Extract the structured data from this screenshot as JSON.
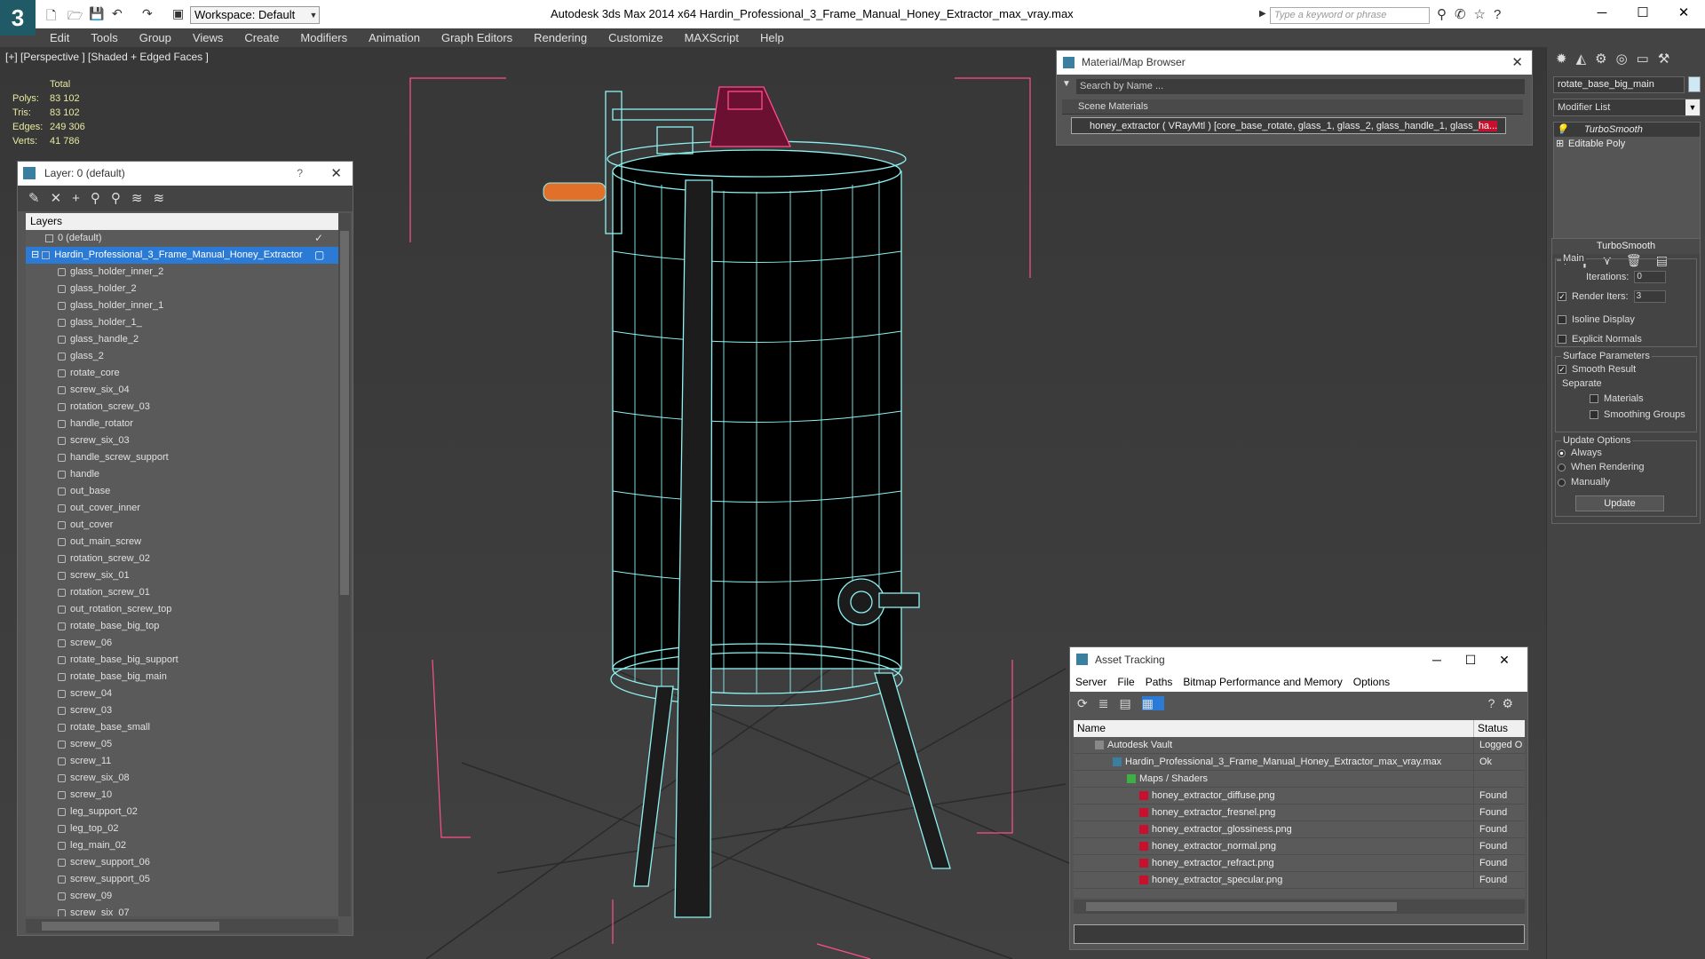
{
  "app": {
    "title": "Autodesk 3ds Max  2014 x64      Hardin_Professional_3_Frame_Manual_Honey_Extractor_max_vray.max",
    "logo": "3",
    "workspace": "Workspace: Default",
    "search_placeholder": "Type a keyword or phrase"
  },
  "menu": [
    "Edit",
    "Tools",
    "Group",
    "Views",
    "Create",
    "Modifiers",
    "Animation",
    "Graph Editors",
    "Rendering",
    "Customize",
    "MAXScript",
    "Help"
  ],
  "viewport": {
    "label": "[+] [Perspective ] [Shaded + Edged Faces ]",
    "stats": {
      "header": "Total",
      "polys_label": "Polys:",
      "polys": "83 102",
      "tris_label": "Tris:",
      "tris": "83 102",
      "edges_label": "Edges:",
      "edges": "249 306",
      "verts_label": "Verts:",
      "verts": "41 786"
    }
  },
  "layer_panel": {
    "title": "Layer: 0 (default)",
    "help": "?",
    "column_header": "Layers",
    "default_layer": "0 (default)",
    "selected_layer": "Hardin_Professional_3_Frame_Manual_Honey_Extractor",
    "items": [
      "glass_holder_inner_2",
      "glass_holder_2",
      "glass_holder_inner_1",
      "glass_holder_1_",
      "glass_handle_2",
      "glass_2",
      "rotate_core",
      "screw_six_04",
      "rotation_screw_03",
      "handle_rotator",
      "screw_six_03",
      "handle_screw_support",
      "handle",
      "out_base",
      "out_cover_inner",
      "out_cover",
      "out_main_screw",
      "rotation_screw_02",
      "screw_six_01",
      "rotation_screw_01",
      "out_rotation_screw_top",
      "rotate_base_big_top",
      "screw_06",
      "rotate_base_big_support",
      "rotate_base_big_main",
      "screw_04",
      "screw_03",
      "rotate_base_small",
      "screw_05",
      "screw_11",
      "screw_six_08",
      "screw_10",
      "leg_support_02",
      "leg_top_02",
      "leg_main_02",
      "screw_support_06",
      "screw_support_05",
      "screw_09",
      "screw_six_07"
    ]
  },
  "material_browser": {
    "title": "Material/Map Browser",
    "search_placeholder": "Search by Name ...",
    "section": "Scene Materials",
    "material_prefix": "honey_extractor  ( VRayMtl ) [core_base_rotate, glass_1, glass_2, glass_handle_1, glass_",
    "material_highlight": "ha..."
  },
  "command_panel": {
    "object_name": "rotate_base_big_main",
    "modifier_list": "Modifier List",
    "stack": [
      "TurboSmooth",
      "Editable Poly"
    ],
    "rollout_title": "TurboSmooth",
    "main_group": "Main",
    "iterations_label": "Iterations:",
    "iterations": "0",
    "render_iters_label": "Render Iters:",
    "render_iters": "3",
    "isoline": "Isoline Display",
    "explicit_normals": "Explicit Normals",
    "surface_group": "Surface Parameters",
    "smooth_result": "Smooth Result",
    "separate": "Separate",
    "materials": "Materials",
    "smoothing_groups": "Smoothing Groups",
    "update_group": "Update Options",
    "always": "Always",
    "when_rendering": "When Rendering",
    "manually": "Manually",
    "update_button": "Update"
  },
  "asset_tracking": {
    "title": "Asset Tracking",
    "menu": [
      "Server",
      "File",
      "Paths",
      "Bitmap Performance and Memory",
      "Options"
    ],
    "col_name": "Name",
    "col_status": "Status",
    "rows": [
      {
        "name": "Autodesk Vault",
        "status": "Logged O"
      },
      {
        "name": "Hardin_Professional_3_Frame_Manual_Honey_Extractor_max_vray.max",
        "status": "Ok"
      },
      {
        "name": "Maps / Shaders",
        "status": ""
      },
      {
        "name": "honey_extractor_diffuse.png",
        "status": "Found"
      },
      {
        "name": "honey_extractor_fresnel.png",
        "status": "Found"
      },
      {
        "name": "honey_extractor_glossiness.png",
        "status": "Found"
      },
      {
        "name": "honey_extractor_normal.png",
        "status": "Found"
      },
      {
        "name": "honey_extractor_refract.png",
        "status": "Found"
      },
      {
        "name": "honey_extractor_specular.png",
        "status": "Found"
      }
    ]
  },
  "colors": {
    "wire": "#8ff2f2",
    "selection": "#ff3a7a",
    "highlight_row": "#2b7bd6",
    "material_highlight": "#c8102e"
  }
}
